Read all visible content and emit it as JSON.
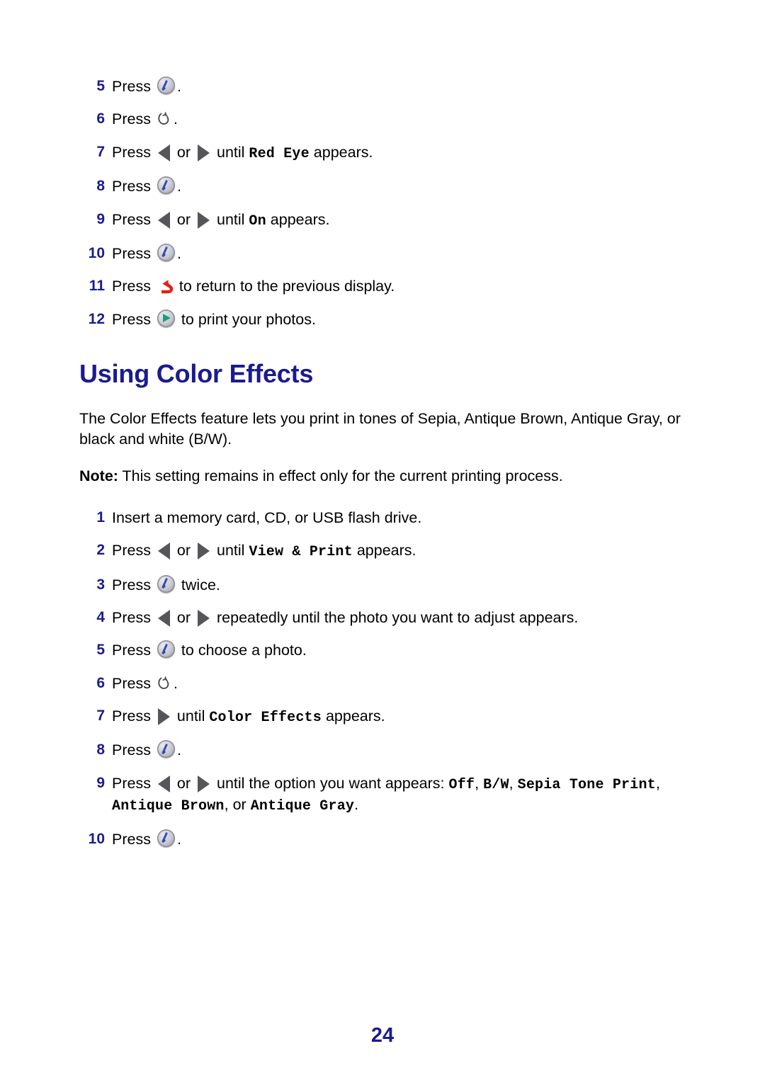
{
  "document": {
    "page_number": "24",
    "heading_color": "#1b1b8f",
    "body_color": "#000000"
  },
  "icons": {
    "select": "select-ok-icon",
    "menu": "menu-icon",
    "arrow_left": "arrow-left-icon",
    "arrow_right": "arrow-right-icon",
    "back": "back-return-icon",
    "start": "start-print-icon"
  },
  "red_eye_procedure": {
    "steps": [
      {
        "number": "5",
        "parts": [
          {
            "type": "text",
            "value": "Press "
          },
          {
            "type": "icon",
            "value": "select"
          },
          {
            "type": "text",
            "value": "."
          }
        ],
        "plain": "Press [select]."
      },
      {
        "number": "6",
        "parts": [
          {
            "type": "text",
            "value": "Press "
          },
          {
            "type": "icon",
            "value": "menu"
          },
          {
            "type": "text",
            "value": "."
          }
        ],
        "plain": "Press [menu]."
      },
      {
        "number": "7",
        "parts": [
          {
            "type": "text",
            "value": "Press "
          },
          {
            "type": "icon",
            "value": "arrow_left"
          },
          {
            "type": "text",
            "value": " or "
          },
          {
            "type": "icon",
            "value": "arrow_right"
          },
          {
            "type": "text",
            "value": " until "
          },
          {
            "type": "mono",
            "value": "Red Eye"
          },
          {
            "type": "text",
            "value": " appears."
          }
        ],
        "plain": "Press [left] or [right] until Red Eye appears."
      },
      {
        "number": "8",
        "parts": [
          {
            "type": "text",
            "value": "Press "
          },
          {
            "type": "icon",
            "value": "select"
          },
          {
            "type": "text",
            "value": "."
          }
        ],
        "plain": "Press [select]."
      },
      {
        "number": "9",
        "parts": [
          {
            "type": "text",
            "value": "Press "
          },
          {
            "type": "icon",
            "value": "arrow_left"
          },
          {
            "type": "text",
            "value": " or "
          },
          {
            "type": "icon",
            "value": "arrow_right"
          },
          {
            "type": "text",
            "value": " until "
          },
          {
            "type": "mono",
            "value": "On"
          },
          {
            "type": "text",
            "value": " appears."
          }
        ],
        "plain": "Press [left] or [right] until On appears."
      },
      {
        "number": "10",
        "parts": [
          {
            "type": "text",
            "value": "Press "
          },
          {
            "type": "icon",
            "value": "select"
          },
          {
            "type": "text",
            "value": "."
          }
        ],
        "plain": "Press [select]."
      },
      {
        "number": "11",
        "parts": [
          {
            "type": "text",
            "value": "Press "
          },
          {
            "type": "icon",
            "value": "back"
          },
          {
            "type": "text",
            "value": " to return to the previous display."
          }
        ],
        "plain": "Press [back] to return to the previous display."
      },
      {
        "number": "12",
        "parts": [
          {
            "type": "text",
            "value": "Press "
          },
          {
            "type": "icon",
            "value": "start"
          },
          {
            "type": "text",
            "value": " to print your photos."
          }
        ],
        "plain": "Press [start] to print your photos."
      }
    ]
  },
  "color_effects_section": {
    "heading": "Using Color Effects",
    "intro": "The Color Effects feature lets you print in tones of Sepia, Antique Brown, Antique Gray, or black and white (B/W).",
    "note_label": "Note:",
    "note_text": "This setting remains in effect only for the current printing process.",
    "steps": [
      {
        "number": "1",
        "parts": [
          {
            "type": "text",
            "value": "Insert a memory card, CD, or USB flash drive."
          }
        ],
        "plain": "Insert a memory card, CD, or USB flash drive."
      },
      {
        "number": "2",
        "parts": [
          {
            "type": "text",
            "value": "Press "
          },
          {
            "type": "icon",
            "value": "arrow_left"
          },
          {
            "type": "text",
            "value": " or "
          },
          {
            "type": "icon",
            "value": "arrow_right"
          },
          {
            "type": "text",
            "value": " until "
          },
          {
            "type": "mono",
            "value": "View & Print"
          },
          {
            "type": "text",
            "value": " appears."
          }
        ],
        "plain": "Press [left] or [right] until View & Print appears."
      },
      {
        "number": "3",
        "parts": [
          {
            "type": "text",
            "value": "Press "
          },
          {
            "type": "icon",
            "value": "select"
          },
          {
            "type": "text",
            "value": " twice."
          }
        ],
        "plain": "Press [select] twice."
      },
      {
        "number": "4",
        "parts": [
          {
            "type": "text",
            "value": "Press "
          },
          {
            "type": "icon",
            "value": "arrow_left"
          },
          {
            "type": "text",
            "value": " or "
          },
          {
            "type": "icon",
            "value": "arrow_right"
          },
          {
            "type": "text",
            "value": " repeatedly until the photo you want to adjust appears."
          }
        ],
        "plain": "Press [left] or [right] repeatedly until the photo you want to adjust appears."
      },
      {
        "number": "5",
        "parts": [
          {
            "type": "text",
            "value": "Press "
          },
          {
            "type": "icon",
            "value": "select"
          },
          {
            "type": "text",
            "value": " to choose a photo."
          }
        ],
        "plain": "Press [select] to choose a photo."
      },
      {
        "number": "6",
        "parts": [
          {
            "type": "text",
            "value": "Press "
          },
          {
            "type": "icon",
            "value": "menu"
          },
          {
            "type": "text",
            "value": "."
          }
        ],
        "plain": "Press [menu]."
      },
      {
        "number": "7",
        "parts": [
          {
            "type": "text",
            "value": "Press "
          },
          {
            "type": "icon",
            "value": "arrow_right"
          },
          {
            "type": "text",
            "value": " until "
          },
          {
            "type": "mono",
            "value": "Color Effects"
          },
          {
            "type": "text",
            "value": " appears."
          }
        ],
        "plain": "Press [right] until Color Effects appears."
      },
      {
        "number": "8",
        "parts": [
          {
            "type": "text",
            "value": "Press "
          },
          {
            "type": "icon",
            "value": "select"
          },
          {
            "type": "text",
            "value": "."
          }
        ],
        "plain": "Press [select]."
      },
      {
        "number": "9",
        "parts": [
          {
            "type": "text",
            "value": "Press "
          },
          {
            "type": "icon",
            "value": "arrow_left"
          },
          {
            "type": "text",
            "value": " or "
          },
          {
            "type": "icon",
            "value": "arrow_right"
          },
          {
            "type": "text",
            "value": " until the option you want appears: "
          },
          {
            "type": "mono",
            "value": "Off"
          },
          {
            "type": "text",
            "value": ", "
          },
          {
            "type": "mono",
            "value": "B/W"
          },
          {
            "type": "text",
            "value": ", "
          },
          {
            "type": "mono",
            "value": "Sepia Tone Print"
          },
          {
            "type": "text",
            "value": ", "
          },
          {
            "type": "mono",
            "value": "Antique Brown"
          },
          {
            "type": "text",
            "value": ", or "
          },
          {
            "type": "mono",
            "value": "Antique Gray"
          },
          {
            "type": "text",
            "value": "."
          }
        ],
        "plain": "Press [left] or [right] until the option you want appears: Off, B/W, Sepia Tone Print, Antique Brown, or Antique Gray."
      },
      {
        "number": "10",
        "parts": [
          {
            "type": "text",
            "value": "Press "
          },
          {
            "type": "icon",
            "value": "select"
          },
          {
            "type": "text",
            "value": "."
          }
        ],
        "plain": "Press [select]."
      }
    ]
  }
}
